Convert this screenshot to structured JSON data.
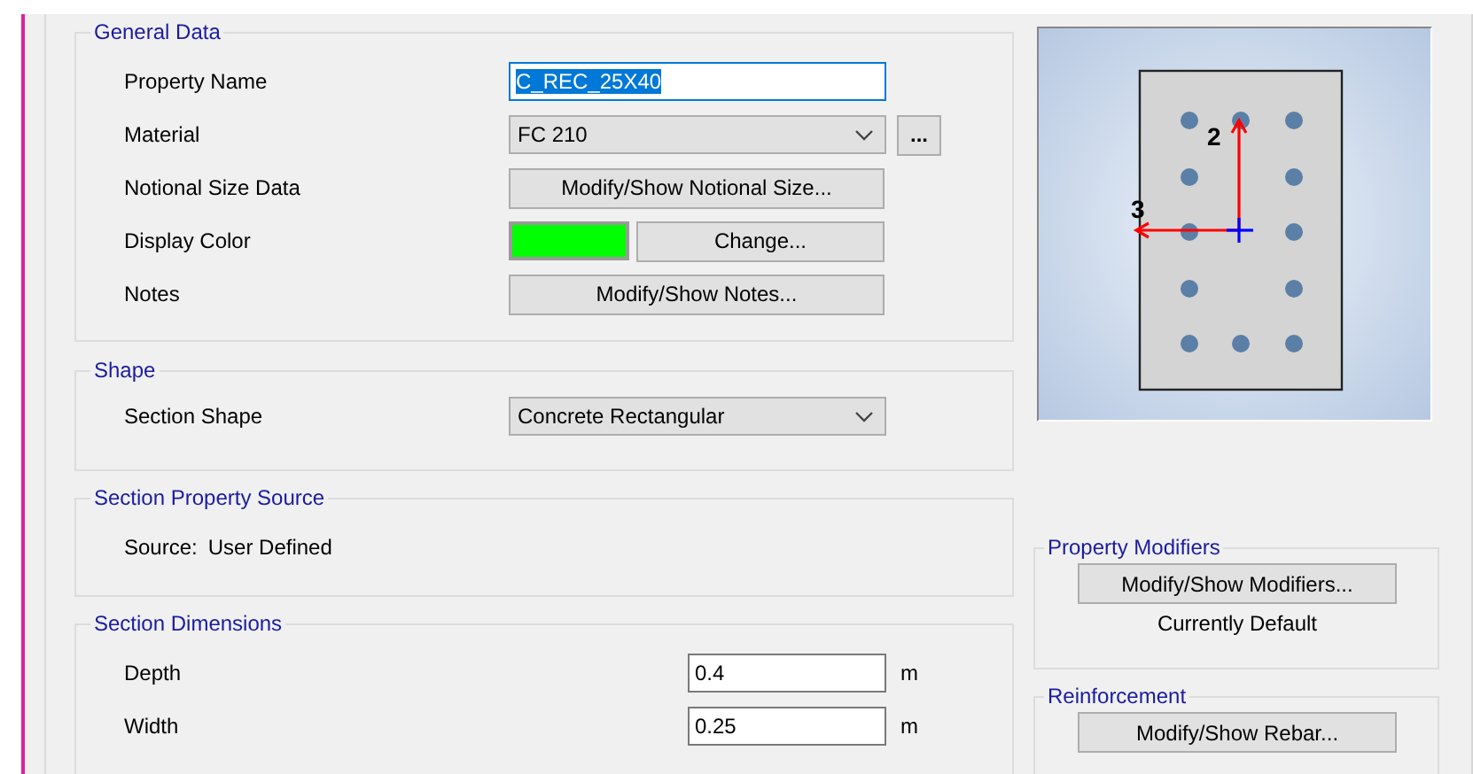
{
  "general_data": {
    "title": "General Data",
    "property_name": {
      "label": "Property Name",
      "value": "C_REC_25X40",
      "text_selected": true
    },
    "material": {
      "label": "Material",
      "value": "FC 210",
      "more_button": "..."
    },
    "notional_size": {
      "label": "Notional Size Data",
      "button": "Modify/Show Notional Size..."
    },
    "display_color": {
      "label": "Display Color",
      "color": "#00ff00",
      "button": "Change..."
    },
    "notes": {
      "label": "Notes",
      "button": "Modify/Show Notes..."
    }
  },
  "shape": {
    "title": "Shape",
    "label": "Section Shape",
    "value": "Concrete Rectangular"
  },
  "property_source": {
    "title": "Section Property Source",
    "label": "Source:",
    "value": "User Defined"
  },
  "section_dimensions": {
    "title": "Section Dimensions",
    "fields": [
      {
        "label": "Depth",
        "value": "0.4",
        "unit": "m"
      },
      {
        "label": "Width",
        "value": "0.25",
        "unit": "m"
      }
    ]
  },
  "section_preview": {
    "axis_2": "2",
    "axis_3": "3"
  },
  "property_modifiers": {
    "title": "Property Modifiers",
    "button": "Modify/Show Modifiers...",
    "status": "Currently Default"
  },
  "reinforcement": {
    "title": "Reinforcement",
    "button": "Modify/Show Rebar..."
  }
}
